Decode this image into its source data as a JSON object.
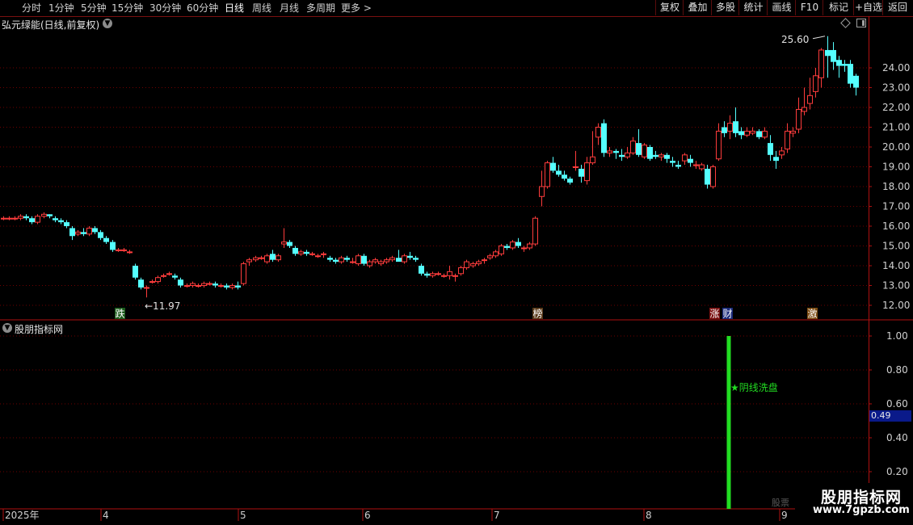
{
  "toolbar": {
    "periods": [
      "分时",
      "1分钟",
      "5分钟",
      "15分钟",
      "30分钟",
      "60分钟",
      "日线",
      "周线",
      "月线",
      "多周期",
      "更多 >"
    ],
    "active_period": "日线",
    "right_buttons": [
      "复权",
      "叠加",
      "多股",
      "统计",
      "画线",
      "F10",
      "标记",
      "+自选",
      "返回"
    ]
  },
  "main_chart": {
    "title": "弘元绿能(日线,前复权)",
    "price_axis_labels": [
      "24.00",
      "23.00",
      "22.00",
      "21.00",
      "20.00",
      "19.00",
      "18.00",
      "17.00",
      "16.00",
      "15.00",
      "14.00",
      "13.00",
      "12.00"
    ],
    "max_label": "25.60",
    "min_label": "11.97",
    "event_markers": [
      "跌",
      "榜",
      "涨",
      "财",
      "激"
    ],
    "colors": {
      "up": "#ff3c3c",
      "down": "#54ffff",
      "grid": "#6e0000",
      "axis": "#b01010"
    }
  },
  "indicator": {
    "title": "股朋指标网",
    "axis_labels": [
      "1.00",
      "0.80",
      "0.60",
      "0.40",
      "0.20"
    ],
    "current_value": "0.49",
    "signal_label": "★阴线洗盘",
    "signal_value": 1.0,
    "signal_color": "#22dd22"
  },
  "time_axis": {
    "labels": [
      "2025年",
      "4",
      "5",
      "6",
      "7",
      "8",
      "9"
    ]
  },
  "watermark": {
    "line1": "股朋指标网",
    "line2": "www.7gpzb.com",
    "ghost": "股票"
  },
  "chart_data": {
    "type": "candlestick",
    "ylim": [
      11.5,
      26.0
    ],
    "candles": [
      [
        16.4,
        16.5,
        16.3,
        16.4
      ],
      [
        16.4,
        16.5,
        16.3,
        16.4
      ],
      [
        16.4,
        16.5,
        16.3,
        16.4
      ],
      [
        16.4,
        16.6,
        16.3,
        16.5
      ],
      [
        16.5,
        16.6,
        16.3,
        16.4
      ],
      [
        16.4,
        16.5,
        16.1,
        16.2
      ],
      [
        16.2,
        16.6,
        16.1,
        16.5
      ],
      [
        16.5,
        16.7,
        16.4,
        16.6
      ],
      [
        16.6,
        16.6,
        16.4,
        16.5
      ],
      [
        16.4,
        16.5,
        16.2,
        16.3
      ],
      [
        16.3,
        16.4,
        16.1,
        16.2
      ],
      [
        16.2,
        16.3,
        15.9,
        16.0
      ],
      [
        15.9,
        16.0,
        15.3,
        15.5
      ],
      [
        15.6,
        15.8,
        15.5,
        15.7
      ],
      [
        15.7,
        15.9,
        15.5,
        15.6
      ],
      [
        15.6,
        16.0,
        15.5,
        15.9
      ],
      [
        15.9,
        16.0,
        15.6,
        15.7
      ],
      [
        15.7,
        15.8,
        15.3,
        15.4
      ],
      [
        15.4,
        15.5,
        15.1,
        15.2
      ],
      [
        15.2,
        15.3,
        14.7,
        14.8
      ],
      [
        14.8,
        14.9,
        14.7,
        14.8
      ],
      [
        14.8,
        14.9,
        14.7,
        14.8
      ],
      [
        14.7,
        14.8,
        14.6,
        14.7
      ],
      [
        14.0,
        14.1,
        13.3,
        13.4
      ],
      [
        13.3,
        13.4,
        12.8,
        12.9
      ],
      [
        12.9,
        13.0,
        12.4,
        12.9
      ],
      [
        13.2,
        13.3,
        13.1,
        13.2
      ],
      [
        13.2,
        13.5,
        13.1,
        13.4
      ],
      [
        13.5,
        13.6,
        13.4,
        13.5
      ],
      [
        13.6,
        13.7,
        13.5,
        13.6
      ],
      [
        13.5,
        13.6,
        13.3,
        13.4
      ],
      [
        13.3,
        13.4,
        12.9,
        13.0
      ],
      [
        13.0,
        13.1,
        12.9,
        13.0
      ],
      [
        13.0,
        13.2,
        12.9,
        13.1
      ],
      [
        13.0,
        13.1,
        12.9,
        13.0
      ],
      [
        13.0,
        13.2,
        12.9,
        13.1
      ],
      [
        13.1,
        13.2,
        13.0,
        13.1
      ],
      [
        13.1,
        13.2,
        12.9,
        13.0
      ],
      [
        13.0,
        13.1,
        12.9,
        13.0
      ],
      [
        13.0,
        13.1,
        12.8,
        12.9
      ],
      [
        12.9,
        13.1,
        12.8,
        13.0
      ],
      [
        13.0,
        13.2,
        12.8,
        12.9
      ],
      [
        13.1,
        14.2,
        13.0,
        14.1
      ],
      [
        14.2,
        14.4,
        14.0,
        14.3
      ],
      [
        14.3,
        14.5,
        14.2,
        14.4
      ],
      [
        14.4,
        14.5,
        14.3,
        14.4
      ],
      [
        14.2,
        14.6,
        14.1,
        14.5
      ],
      [
        14.6,
        14.8,
        14.2,
        14.3
      ],
      [
        14.3,
        14.6,
        14.2,
        14.5
      ],
      [
        15.1,
        15.9,
        14.9,
        15.2
      ],
      [
        15.2,
        15.3,
        14.9,
        15.0
      ],
      [
        14.9,
        15.0,
        14.5,
        14.6
      ],
      [
        14.6,
        14.8,
        14.5,
        14.7
      ],
      [
        14.7,
        14.8,
        14.5,
        14.6
      ],
      [
        14.6,
        14.7,
        14.5,
        14.6
      ],
      [
        14.5,
        14.6,
        14.4,
        14.5
      ],
      [
        14.6,
        14.7,
        14.4,
        14.6
      ],
      [
        14.4,
        14.5,
        14.2,
        14.3
      ],
      [
        14.3,
        14.4,
        14.1,
        14.2
      ],
      [
        14.2,
        14.5,
        14.1,
        14.4
      ],
      [
        14.4,
        14.5,
        14.2,
        14.3
      ],
      [
        14.2,
        14.4,
        14.1,
        14.2
      ],
      [
        14.1,
        14.6,
        14.0,
        14.5
      ],
      [
        14.5,
        14.6,
        14.0,
        14.1
      ],
      [
        14.0,
        14.3,
        13.9,
        14.2
      ],
      [
        14.2,
        14.4,
        14.1,
        14.3
      ],
      [
        14.1,
        14.3,
        14.0,
        14.2
      ],
      [
        14.2,
        14.4,
        14.1,
        14.3
      ],
      [
        14.3,
        14.5,
        14.2,
        14.4
      ],
      [
        14.4,
        14.8,
        14.3,
        14.2
      ],
      [
        14.2,
        14.6,
        14.1,
        14.5
      ],
      [
        14.5,
        14.7,
        14.3,
        14.4
      ],
      [
        14.4,
        14.5,
        14.2,
        14.3
      ],
      [
        14.0,
        14.1,
        13.5,
        13.6
      ],
      [
        13.6,
        13.7,
        13.4,
        13.5
      ],
      [
        13.5,
        13.7,
        13.4,
        13.6
      ],
      [
        13.6,
        13.7,
        13.5,
        13.6
      ],
      [
        13.5,
        13.6,
        13.4,
        13.5
      ],
      [
        13.5,
        14.0,
        13.3,
        13.7
      ],
      [
        13.5,
        13.6,
        13.2,
        13.5
      ],
      [
        13.6,
        14.0,
        13.5,
        13.9
      ],
      [
        13.9,
        14.3,
        13.8,
        14.2
      ],
      [
        14.0,
        14.2,
        13.9,
        14.1
      ],
      [
        14.1,
        14.3,
        14.0,
        14.2
      ],
      [
        14.3,
        14.4,
        14.1,
        14.3
      ],
      [
        14.4,
        14.6,
        14.3,
        14.5
      ],
      [
        14.5,
        14.8,
        14.4,
        14.7
      ],
      [
        14.6,
        15.1,
        14.5,
        15.0
      ],
      [
        15.0,
        15.1,
        14.8,
        14.9
      ],
      [
        14.9,
        15.3,
        14.8,
        15.2
      ],
      [
        15.2,
        15.4,
        14.9,
        15.0
      ],
      [
        14.9,
        15.0,
        14.7,
        14.9
      ],
      [
        14.9,
        15.2,
        14.8,
        15.1
      ],
      [
        15.1,
        16.5,
        15.0,
        16.4
      ],
      [
        17.5,
        18.8,
        17.0,
        18.0
      ],
      [
        18.0,
        19.3,
        17.9,
        19.2
      ],
      [
        19.2,
        19.5,
        18.7,
        18.8
      ],
      [
        18.8,
        19.1,
        18.5,
        18.6
      ],
      [
        18.6,
        18.8,
        18.3,
        18.4
      ],
      [
        18.4,
        18.5,
        18.1,
        18.2
      ],
      [
        19.0,
        19.8,
        18.8,
        19.0
      ],
      [
        18.9,
        19.1,
        18.2,
        18.5
      ],
      [
        18.3,
        19.5,
        18.1,
        19.2
      ],
      [
        19.2,
        20.8,
        19.1,
        19.5
      ],
      [
        20.5,
        21.2,
        20.1,
        21.0
      ],
      [
        21.2,
        21.4,
        19.5,
        19.7
      ],
      [
        19.7,
        20.0,
        19.5,
        19.8
      ],
      [
        19.8,
        19.9,
        19.4,
        19.7
      ],
      [
        19.6,
        19.9,
        19.3,
        19.5
      ],
      [
        19.5,
        20.0,
        19.4,
        19.7
      ],
      [
        19.7,
        20.5,
        19.6,
        20.3
      ],
      [
        20.2,
        20.9,
        19.5,
        19.6
      ],
      [
        19.5,
        20.2,
        19.4,
        20.1
      ],
      [
        20.0,
        20.1,
        19.3,
        19.4
      ],
      [
        19.6,
        19.8,
        19.4,
        19.5
      ],
      [
        19.5,
        19.7,
        19.3,
        19.6
      ],
      [
        19.6,
        19.7,
        19.2,
        19.4
      ],
      [
        19.3,
        19.5,
        19.0,
        19.2
      ],
      [
        19.1,
        19.3,
        18.9,
        19.0
      ],
      [
        19.3,
        19.7,
        19.1,
        19.6
      ],
      [
        19.4,
        19.6,
        19.0,
        19.2
      ],
      [
        19.1,
        19.3,
        18.9,
        19.1
      ],
      [
        18.9,
        19.2,
        18.8,
        19.1
      ],
      [
        18.9,
        19.1,
        17.9,
        18.1
      ],
      [
        18.0,
        19.1,
        17.9,
        19.0
      ],
      [
        19.4,
        21.2,
        19.3,
        20.8
      ],
      [
        21.0,
        21.3,
        20.5,
        20.7
      ],
      [
        20.8,
        21.6,
        20.4,
        21.2
      ],
      [
        21.3,
        22.0,
        20.5,
        20.7
      ],
      [
        20.8,
        21.0,
        20.4,
        20.6
      ],
      [
        20.6,
        21.0,
        20.5,
        20.8
      ],
      [
        20.7,
        21.0,
        20.6,
        20.8
      ],
      [
        20.8,
        20.9,
        20.4,
        20.5
      ],
      [
        20.5,
        21.0,
        20.4,
        20.8
      ],
      [
        20.2,
        20.6,
        19.3,
        19.6
      ],
      [
        19.5,
        19.8,
        18.9,
        19.3
      ],
      [
        19.6,
        20.0,
        19.4,
        19.8
      ],
      [
        19.9,
        21.2,
        19.7,
        20.8
      ],
      [
        20.7,
        21.0,
        20.5,
        20.8
      ],
      [
        20.9,
        22.5,
        20.7,
        21.9
      ],
      [
        21.8,
        23.0,
        21.6,
        22.0
      ],
      [
        22.2,
        23.5,
        21.9,
        22.6
      ],
      [
        22.8,
        24.0,
        22.5,
        23.6
      ],
      [
        23.5,
        25.0,
        23.0,
        24.9
      ],
      [
        24.9,
        25.6,
        23.5,
        24.6
      ],
      [
        24.9,
        25.3,
        23.9,
        24.3
      ],
      [
        24.4,
        24.6,
        23.5,
        24.1
      ],
      [
        24.2,
        24.4,
        23.8,
        24.1
      ],
      [
        24.2,
        24.4,
        23.0,
        23.2
      ],
      [
        23.6,
        23.7,
        22.6,
        23.0
      ]
    ]
  }
}
